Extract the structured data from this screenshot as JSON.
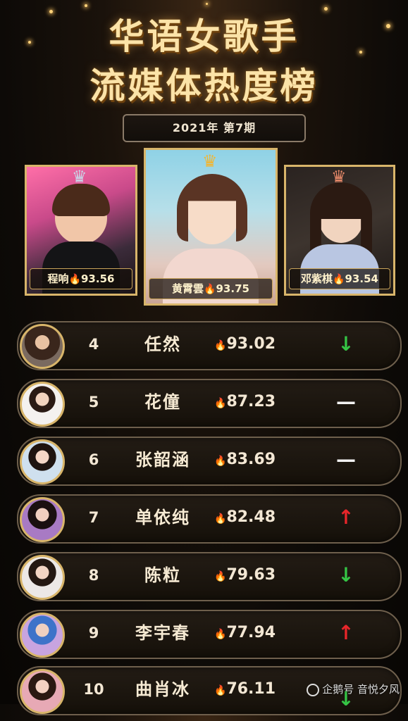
{
  "header": {
    "title_line1": "华语女歌手",
    "title_line2": "流媒体热度榜",
    "period": "2021年 第7期"
  },
  "podium": [
    {
      "name": "程响",
      "score": "93.56",
      "crown_color": "#c9d6e8"
    },
    {
      "name": "黄霄雲",
      "score": "93.75",
      "crown_color": "#f2b531"
    },
    {
      "name": "邓紫棋",
      "score": "93.54",
      "crown_color": "#e98a6a"
    }
  ],
  "fire_icon": "🔥",
  "list": [
    {
      "rank": "4",
      "name": "任然",
      "score": "93.02",
      "trend": "↓",
      "trend_icon": "arrow-down-icon",
      "trend_color": "#35c545"
    },
    {
      "rank": "5",
      "name": "花僮",
      "score": "87.23",
      "trend": "—",
      "trend_icon": "dash-icon",
      "trend_color": "#f2f2f2"
    },
    {
      "rank": "6",
      "name": "张韶涵",
      "score": "83.69",
      "trend": "—",
      "trend_icon": "dash-icon",
      "trend_color": "#f2f2f2"
    },
    {
      "rank": "7",
      "name": "单依纯",
      "score": "82.48",
      "trend": "↑",
      "trend_icon": "arrow-up-icon",
      "trend_color": "#e8262a"
    },
    {
      "rank": "8",
      "name": "陈粒",
      "score": "79.63",
      "trend": "↓",
      "trend_icon": "arrow-down-icon",
      "trend_color": "#35c545"
    },
    {
      "rank": "9",
      "name": "李宇春",
      "score": "77.94",
      "trend": "↑",
      "trend_icon": "arrow-up-icon",
      "trend_color": "#e8262a"
    },
    {
      "rank": "10",
      "name": "曲肖冰",
      "score": "76.11",
      "trend": "↓",
      "trend_icon": "arrow-down-icon",
      "trend_color": "#35c545"
    }
  ],
  "watermark": "企鹅号 音悦夕风",
  "colors": {
    "gold": "#d8b56a",
    "accent_up": "#e8262a",
    "accent_down": "#35c545"
  }
}
